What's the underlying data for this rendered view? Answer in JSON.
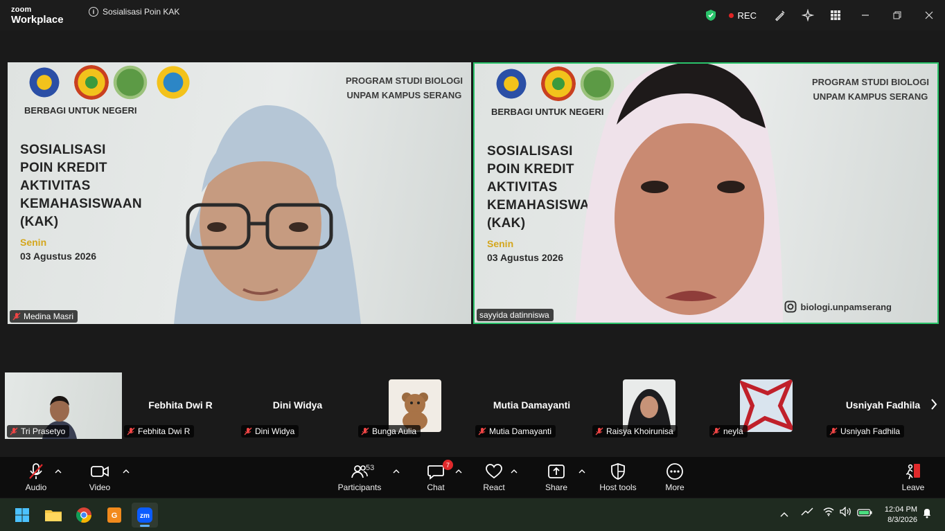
{
  "window": {
    "brand_line1": "zoom",
    "brand_line2": "Workplace",
    "meeting_title": "Sosialisasi Poin KAK",
    "rec_label": "REC",
    "shield_color": "#2ac36a",
    "rec_color": "#e02424"
  },
  "slide": {
    "berbagi": "BERBAGI UNTUK NEGERI",
    "program_line1": "PROGRAM STUDI BIOLOGI",
    "program_line2": "UNPAM KAMPUS SERANG",
    "title_lines": [
      "SOSIALISASI",
      "POIN KREDIT",
      "AKTIVITAS",
      "KEMAHASISWAAN",
      "(KAK)"
    ],
    "day": "Senin",
    "date": "03 Agustus 2026",
    "instagram": "biologi.unpamserang"
  },
  "main_tiles": [
    {
      "name": "Medina Masri",
      "muted": true
    },
    {
      "name": "sayyida datinniswa",
      "muted": false,
      "active_speaker": true
    }
  ],
  "thumbnails": [
    {
      "name": "Tri Prasetyo",
      "muted": true,
      "display": "video"
    },
    {
      "name": "Febhita Dwi R",
      "muted": true,
      "display": "text"
    },
    {
      "name": "Dini Widya",
      "muted": true,
      "display": "text"
    },
    {
      "name": "Bunga Aulia",
      "muted": true,
      "display": "avatar"
    },
    {
      "name": "Mutia Damayanti",
      "muted": true,
      "display": "text"
    },
    {
      "name": "Raisya Khoirunisa",
      "muted": true,
      "display": "avatar"
    },
    {
      "name": "neyla",
      "muted": true,
      "display": "avatar"
    },
    {
      "name": "Usniyah Fadhila",
      "muted": true,
      "display": "text"
    }
  ],
  "toolbar": {
    "audio": "Audio",
    "video": "Video",
    "participants": "Participants",
    "participants_count": "53",
    "chat": "Chat",
    "chat_badge": "7",
    "react": "React",
    "share": "Share",
    "host_tools": "Host tools",
    "more": "More",
    "leave": "Leave",
    "leave_color": "#e0292b"
  },
  "taskbar": {
    "time": "12:04 PM",
    "date": "8/3/2026",
    "apps": [
      "start-icon",
      "file-explorer-icon",
      "chrome-icon",
      "pdf-app-icon",
      "zoom-app-icon"
    ]
  }
}
